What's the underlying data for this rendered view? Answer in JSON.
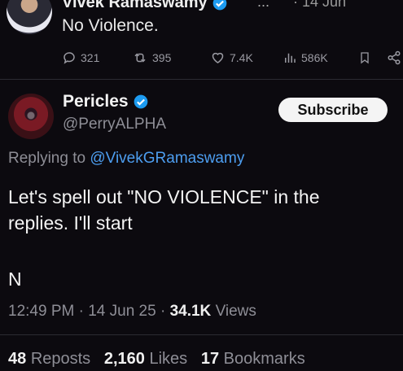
{
  "parent_tweet": {
    "author_name": "Vivek Ramaswamy",
    "more": "...",
    "date": "· 14 Jun",
    "text": "No Violence.",
    "actions": {
      "replies": "321",
      "reposts": "395",
      "likes": "7.4K",
      "views": "586K"
    }
  },
  "reply_tweet": {
    "author_name": "Pericles",
    "handle": "@PerryALPHA",
    "subscribe_label": "Subscribe",
    "replying_prefix": "Replying to",
    "replying_to": "@VivekGRamaswamy",
    "text_line1": "Let's spell out \"NO VIOLENCE\" in the",
    "text_line2": "replies. I'll start",
    "text_letter": "N",
    "time": "12:49 PM",
    "date": "14 Jun 25",
    "views_count": "34.1K",
    "views_label": "Views",
    "reposts_count": "48",
    "reposts_label": "Reposts",
    "likes_count": "2,160",
    "likes_label": "Likes",
    "bookmarks_count": "17",
    "bookmarks_label": "Bookmarks"
  },
  "colors": {
    "accent": "#4d9ef0",
    "verified": "#1d9bf0",
    "background": "#0c0a0f"
  },
  "icons": [
    "reply-icon",
    "repost-icon",
    "like-icon",
    "views-icon",
    "bookmark-icon",
    "share-icon",
    "verified-icon"
  ]
}
